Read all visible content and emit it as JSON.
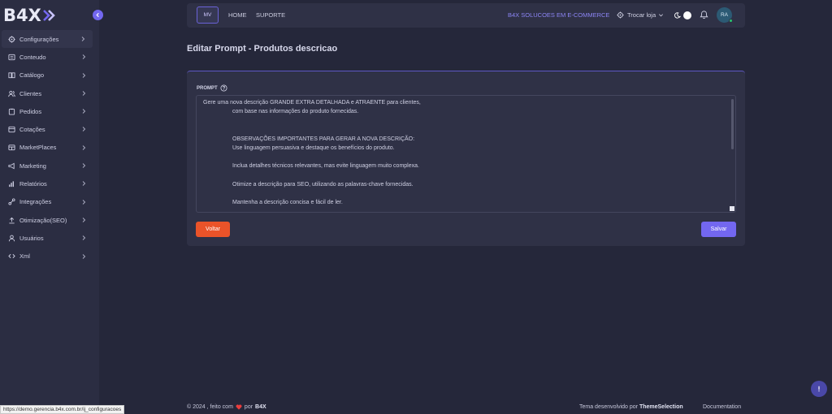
{
  "brand": {
    "logo_text": "B4X"
  },
  "sidebar": {
    "items": [
      {
        "label": "Configurações",
        "icon": "gear-icon",
        "active": true
      },
      {
        "label": "Conteudo",
        "icon": "document-icon"
      },
      {
        "label": "Catálogo",
        "icon": "book-icon"
      },
      {
        "label": "Clientes",
        "icon": "users-icon"
      },
      {
        "label": "Pedidos",
        "icon": "clipboard-icon"
      },
      {
        "label": "Cotações",
        "icon": "quote-icon"
      },
      {
        "label": "MarketPlaces",
        "icon": "store-icon"
      },
      {
        "label": "Marketing",
        "icon": "megaphone-icon"
      },
      {
        "label": "Relatórios",
        "icon": "bar-chart-icon"
      },
      {
        "label": "Integrações",
        "icon": "integration-icon"
      },
      {
        "label": "Otimização(SEO)",
        "icon": "upload-icon"
      },
      {
        "label": "Usuários",
        "icon": "user-icon"
      },
      {
        "label": "Xml",
        "icon": "code-icon"
      }
    ]
  },
  "navbar": {
    "store_badge": "MV",
    "links": [
      "HOME",
      "SUPORTE"
    ],
    "company": "B4X SOLUCOES EM E-COMMERCE",
    "switch_store": "Trocar loja",
    "avatar_initials": "RA"
  },
  "page": {
    "title": "Editar Prompt - Produtos descricao",
    "field_label": "PROMPT",
    "prompt_lines": [
      "Gere uma nova descrição GRANDE EXTRA DETALHADA e ATRAENTE para clientes,",
      "com base nas informações do produto fornecidas.",
      "",
      "OBSERVAÇÕES IMPORTANTES PARA GERAR A NOVA DESCRIÇÃO:",
      "Use linguagem persuasiva e destaque os benefícios do produto.",
      "",
      "Inclua detalhes técnicos relevantes, mas evite linguagem muito complexa.",
      "",
      "Otimize a descrição para SEO, utilizando as palavras-chave fornecidas.",
      "",
      "Mantenha a descrição concisa e fácil de ler."
    ],
    "back_button": "Voltar",
    "save_button": "Salvar"
  },
  "footer": {
    "prefix": "© 2024 , feito com",
    "by": "por",
    "brand": "B4X",
    "theme_prefix": "Tema desenvolvido por",
    "theme_author": "ThemeSelection",
    "documentation": "Documentation"
  },
  "status_bar": {
    "url": "https://demo.gerencia.b4x.com.br/ij_configuracoes"
  },
  "colors": {
    "accent": "#7367f0",
    "danger": "#ea5329",
    "background": "#25273a",
    "card": "#2f3146",
    "sidebar": "#2b2d42"
  }
}
